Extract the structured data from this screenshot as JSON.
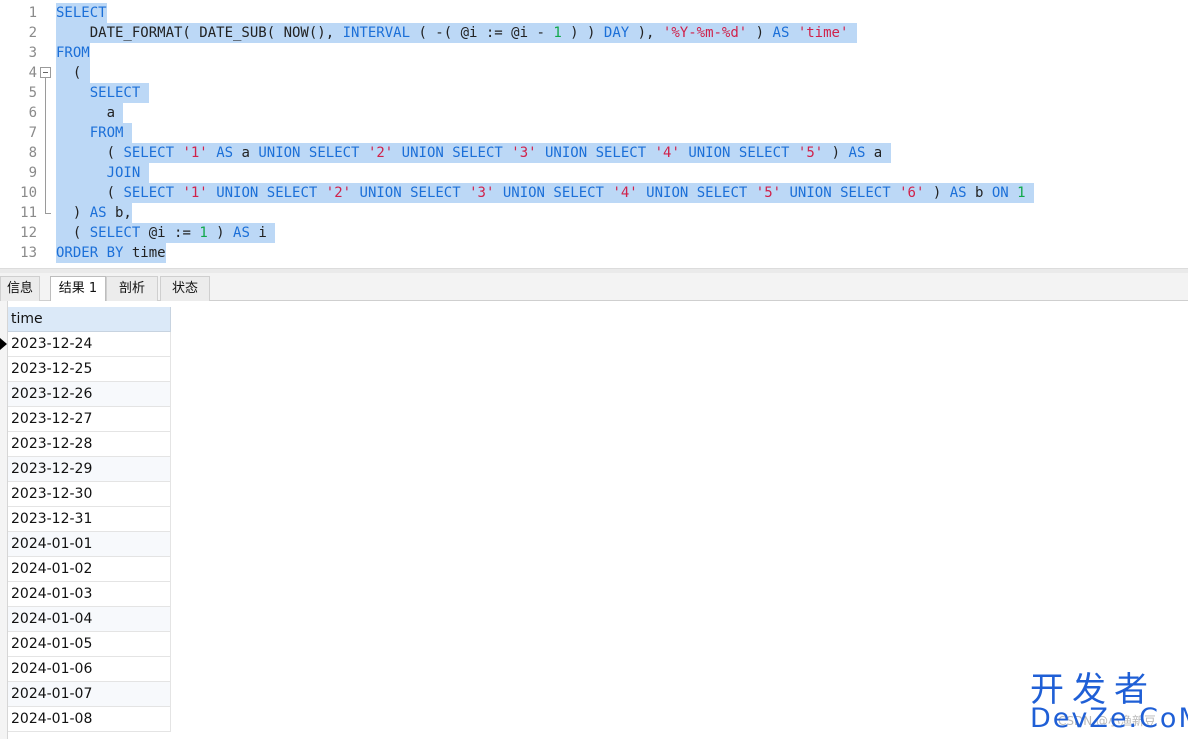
{
  "editor": {
    "line_numbers": [
      "1",
      "2",
      "3",
      "4",
      "5",
      "6",
      "7",
      "8",
      "9",
      "10",
      "11",
      "12",
      "13"
    ],
    "lines": [
      [
        {
          "t": "SELECT",
          "c": "kw"
        }
      ],
      [
        {
          "t": "    DATE_FORMAT( DATE_SUB( NOW(), ",
          "c": "fn"
        },
        {
          "t": "INTERVAL",
          "c": "kw"
        },
        {
          "t": " ( -( @i := @i - ",
          "c": "fn"
        },
        {
          "t": "1",
          "c": "num"
        },
        {
          "t": " ) ) ",
          "c": "fn"
        },
        {
          "t": "DAY",
          "c": "kw"
        },
        {
          "t": " ), ",
          "c": "fn"
        },
        {
          "t": "'%Y-%m-%d'",
          "c": "str"
        },
        {
          "t": " ) ",
          "c": "fn"
        },
        {
          "t": "AS",
          "c": "kw"
        },
        {
          "t": " ",
          "c": "fn"
        },
        {
          "t": "'time'",
          "c": "str"
        },
        {
          "t": " ",
          "c": "fn"
        }
      ],
      [
        {
          "t": "FROM",
          "c": "kw"
        }
      ],
      [
        {
          "t": "  ( ",
          "c": "fn"
        }
      ],
      [
        {
          "t": "    ",
          "c": "fn"
        },
        {
          "t": "SELECT",
          "c": "kw"
        },
        {
          "t": " ",
          "c": "fn"
        }
      ],
      [
        {
          "t": "      a ",
          "c": "fn"
        }
      ],
      [
        {
          "t": "    ",
          "c": "fn"
        },
        {
          "t": "FROM",
          "c": "kw"
        },
        {
          "t": " ",
          "c": "fn"
        }
      ],
      [
        {
          "t": "      ( ",
          "c": "fn"
        },
        {
          "t": "SELECT",
          "c": "kw"
        },
        {
          "t": " ",
          "c": "fn"
        },
        {
          "t": "'1'",
          "c": "str"
        },
        {
          "t": " ",
          "c": "fn"
        },
        {
          "t": "AS",
          "c": "kw"
        },
        {
          "t": " a ",
          "c": "fn"
        },
        {
          "t": "UNION SELECT",
          "c": "kw"
        },
        {
          "t": " ",
          "c": "fn"
        },
        {
          "t": "'2'",
          "c": "str"
        },
        {
          "t": " ",
          "c": "fn"
        },
        {
          "t": "UNION SELECT",
          "c": "kw"
        },
        {
          "t": " ",
          "c": "fn"
        },
        {
          "t": "'3'",
          "c": "str"
        },
        {
          "t": " ",
          "c": "fn"
        },
        {
          "t": "UNION SELECT",
          "c": "kw"
        },
        {
          "t": " ",
          "c": "fn"
        },
        {
          "t": "'4'",
          "c": "str"
        },
        {
          "t": " ",
          "c": "fn"
        },
        {
          "t": "UNION SELECT",
          "c": "kw"
        },
        {
          "t": " ",
          "c": "fn"
        },
        {
          "t": "'5'",
          "c": "str"
        },
        {
          "t": " ) ",
          "c": "fn"
        },
        {
          "t": "AS",
          "c": "kw"
        },
        {
          "t": " a ",
          "c": "fn"
        }
      ],
      [
        {
          "t": "      ",
          "c": "fn"
        },
        {
          "t": "JOIN",
          "c": "kw"
        },
        {
          "t": " ",
          "c": "fn"
        }
      ],
      [
        {
          "t": "      ( ",
          "c": "fn"
        },
        {
          "t": "SELECT",
          "c": "kw"
        },
        {
          "t": " ",
          "c": "fn"
        },
        {
          "t": "'1'",
          "c": "str"
        },
        {
          "t": " ",
          "c": "fn"
        },
        {
          "t": "UNION SELECT",
          "c": "kw"
        },
        {
          "t": " ",
          "c": "fn"
        },
        {
          "t": "'2'",
          "c": "str"
        },
        {
          "t": " ",
          "c": "fn"
        },
        {
          "t": "UNION SELECT",
          "c": "kw"
        },
        {
          "t": " ",
          "c": "fn"
        },
        {
          "t": "'3'",
          "c": "str"
        },
        {
          "t": " ",
          "c": "fn"
        },
        {
          "t": "UNION SELECT",
          "c": "kw"
        },
        {
          "t": " ",
          "c": "fn"
        },
        {
          "t": "'4'",
          "c": "str"
        },
        {
          "t": " ",
          "c": "fn"
        },
        {
          "t": "UNION SELECT",
          "c": "kw"
        },
        {
          "t": " ",
          "c": "fn"
        },
        {
          "t": "'5'",
          "c": "str"
        },
        {
          "t": " ",
          "c": "fn"
        },
        {
          "t": "UNION SELECT",
          "c": "kw"
        },
        {
          "t": " ",
          "c": "fn"
        },
        {
          "t": "'6'",
          "c": "str"
        },
        {
          "t": " ) ",
          "c": "fn"
        },
        {
          "t": "AS",
          "c": "kw"
        },
        {
          "t": " b ",
          "c": "fn"
        },
        {
          "t": "ON",
          "c": "kw"
        },
        {
          "t": " ",
          "c": "fn"
        },
        {
          "t": "1",
          "c": "num"
        },
        {
          "t": " ",
          "c": "fn"
        }
      ],
      [
        {
          "t": "  ) ",
          "c": "fn"
        },
        {
          "t": "AS",
          "c": "kw"
        },
        {
          "t": " b,",
          "c": "fn"
        }
      ],
      [
        {
          "t": "  ( ",
          "c": "fn"
        },
        {
          "t": "SELECT",
          "c": "kw"
        },
        {
          "t": " @i := ",
          "c": "fn"
        },
        {
          "t": "1",
          "c": "num"
        },
        {
          "t": " ) ",
          "c": "fn"
        },
        {
          "t": "AS",
          "c": "kw"
        },
        {
          "t": " i ",
          "c": "fn"
        }
      ],
      [
        {
          "t": "ORDER BY",
          "c": "kw"
        },
        {
          "t": " time",
          "c": "fn"
        }
      ]
    ]
  },
  "tabs": [
    {
      "label": "信息",
      "active": false
    },
    {
      "label": "结果 1",
      "active": true
    },
    {
      "label": "剖析",
      "active": false
    },
    {
      "label": "状态",
      "active": false
    }
  ],
  "results": {
    "column": "time",
    "rows": [
      "2023-12-24",
      "2023-12-25",
      "2023-12-26",
      "2023-12-27",
      "2023-12-28",
      "2023-12-29",
      "2023-12-30",
      "2023-12-31",
      "2024-01-01",
      "2024-01-02",
      "2024-01-03",
      "2024-01-04",
      "2024-01-05",
      "2024-01-06",
      "2024-01-07",
      "2024-01-08"
    ]
  },
  "watermark": {
    "cn": "开发者",
    "en": "DevZe.CoM",
    "faint": "CSDN @小渔新豆"
  },
  "colors": {
    "keyword": "#1b6fd8",
    "string": "#d0224b",
    "number": "#10a84a",
    "selection": "#bcd8f6",
    "header": "#dbe9f8",
    "watermark": "#1f5fd6"
  }
}
